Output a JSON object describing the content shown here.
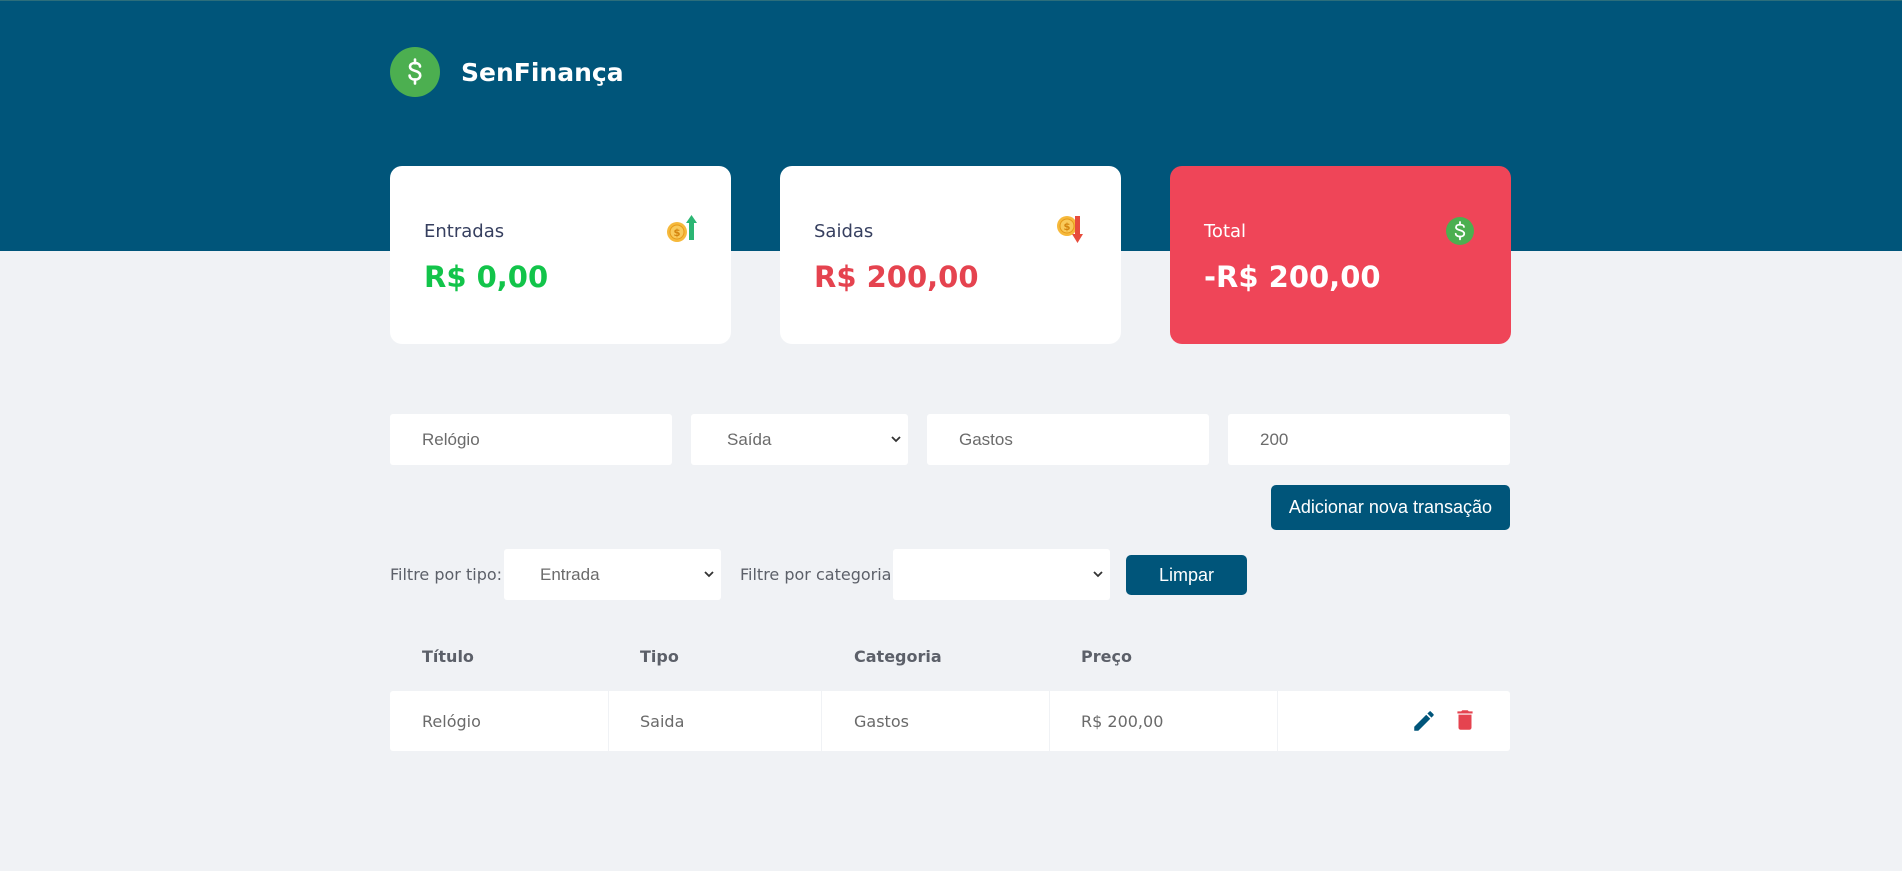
{
  "brand": {
    "name": "SenFinança"
  },
  "summary": {
    "income": {
      "label": "Entradas",
      "value": "R$ 0,00"
    },
    "expense": {
      "label": "Saidas",
      "value": "R$ 200,00"
    },
    "total": {
      "label": "Total",
      "value": "-R$ 200,00"
    }
  },
  "form": {
    "title_value": "Relógio",
    "type_value": "Saída",
    "category_value": "Gastos",
    "price_value": "200",
    "add_button": "Adicionar nova transação"
  },
  "filters": {
    "type_label": "Filtre por tipo:",
    "type_value": "Entrada",
    "category_label": "Filtre por categoria:",
    "category_value": "",
    "clear_button": "Limpar"
  },
  "table": {
    "headers": [
      "Título",
      "Tipo",
      "Categoria",
      "Preço"
    ],
    "rows": [
      {
        "title": "Relógio",
        "type": "Saida",
        "category": "Gastos",
        "price": "R$ 200,00"
      }
    ]
  },
  "colors": {
    "header": "#00557A",
    "income": "#12C44A",
    "expense": "#E5434F",
    "total_card": "#EF4558",
    "brand_green": "#4CAF50"
  },
  "icons": {
    "brand": "dollar-circle-icon",
    "income": "coin-arrow-up-icon",
    "expense": "coin-arrow-down-icon",
    "total": "dollar-circle-icon",
    "edit": "pencil-icon",
    "delete": "trash-icon"
  }
}
